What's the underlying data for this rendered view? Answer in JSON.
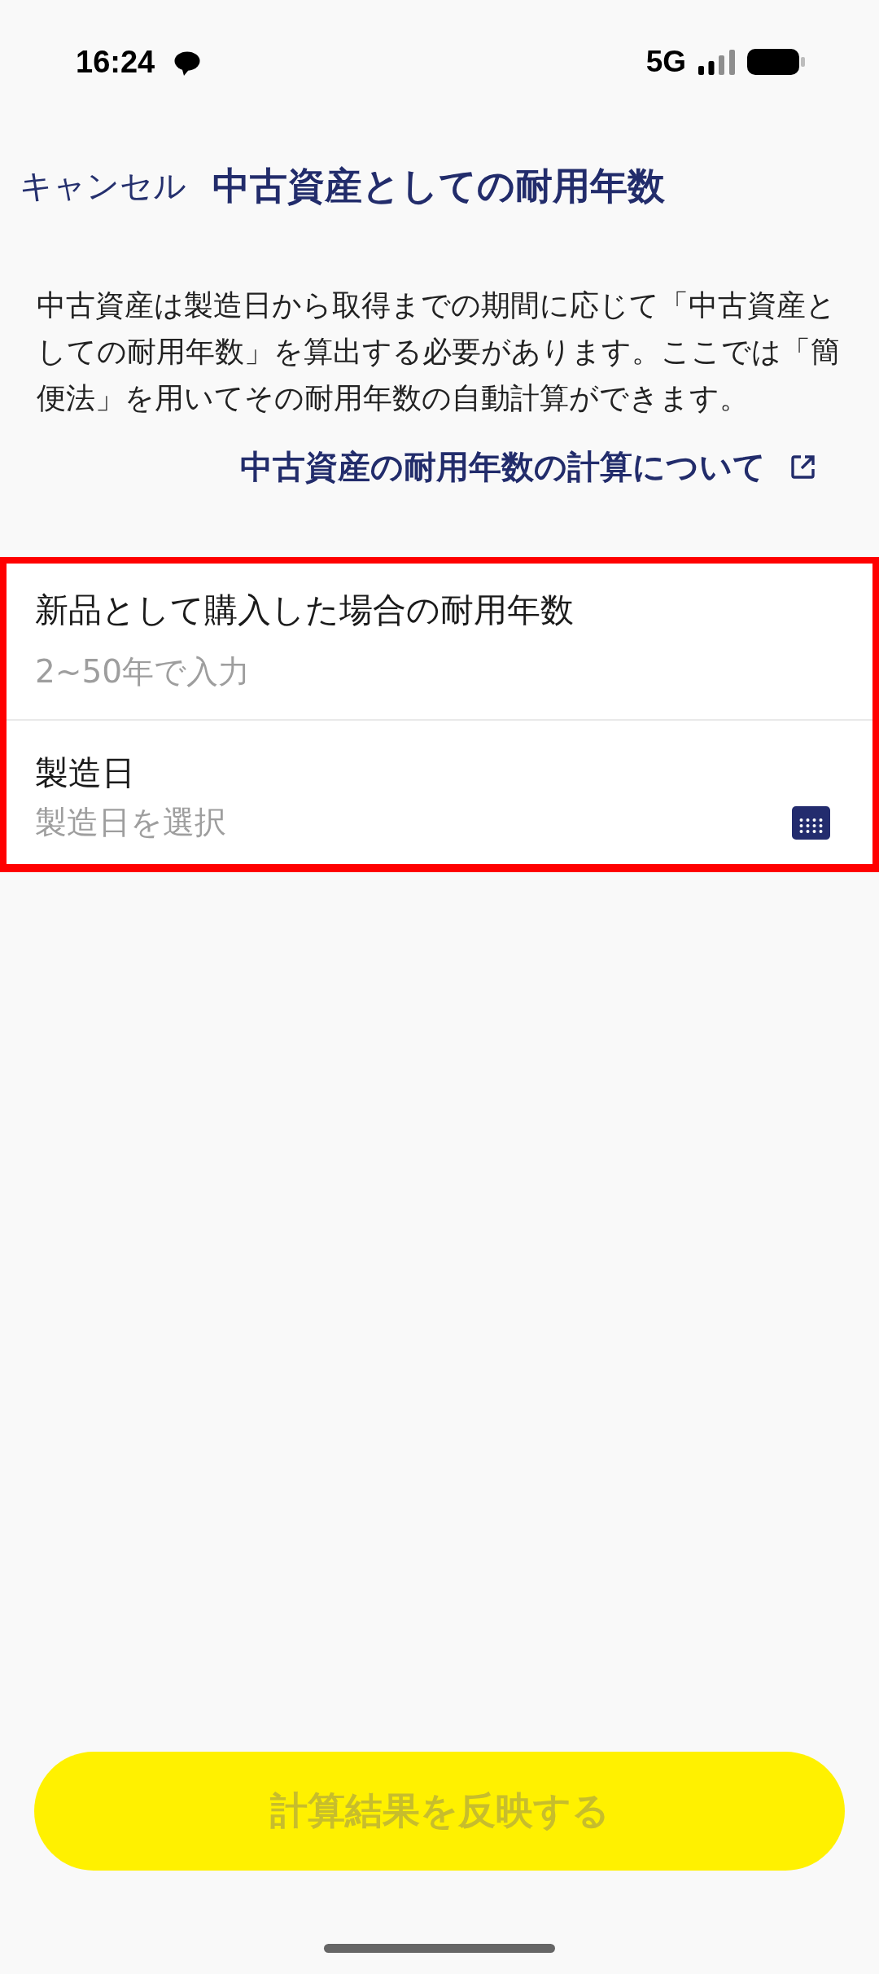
{
  "status_bar": {
    "time": "16:24",
    "network": "5G"
  },
  "header": {
    "cancel": "キャンセル",
    "title": "中古資産としての耐用年数"
  },
  "description": "中古資産は製造日から取得までの期間に応じて「中古資産としての耐用年数」を算出する必要があります。ここでは「簡便法」を用いてその耐用年数の自動計算ができます。",
  "link": {
    "label": "中古資産の耐用年数の計算について"
  },
  "form": {
    "highlighted": true,
    "fields": [
      {
        "kind": "number",
        "label": "新品として購入した場合の耐用年数",
        "placeholder": "2~50年で入力"
      },
      {
        "kind": "date",
        "label": "製造日",
        "placeholder": "製造日を選択"
      }
    ]
  },
  "submit_button": {
    "label": "計算結果を反映する",
    "disabled": true
  }
}
